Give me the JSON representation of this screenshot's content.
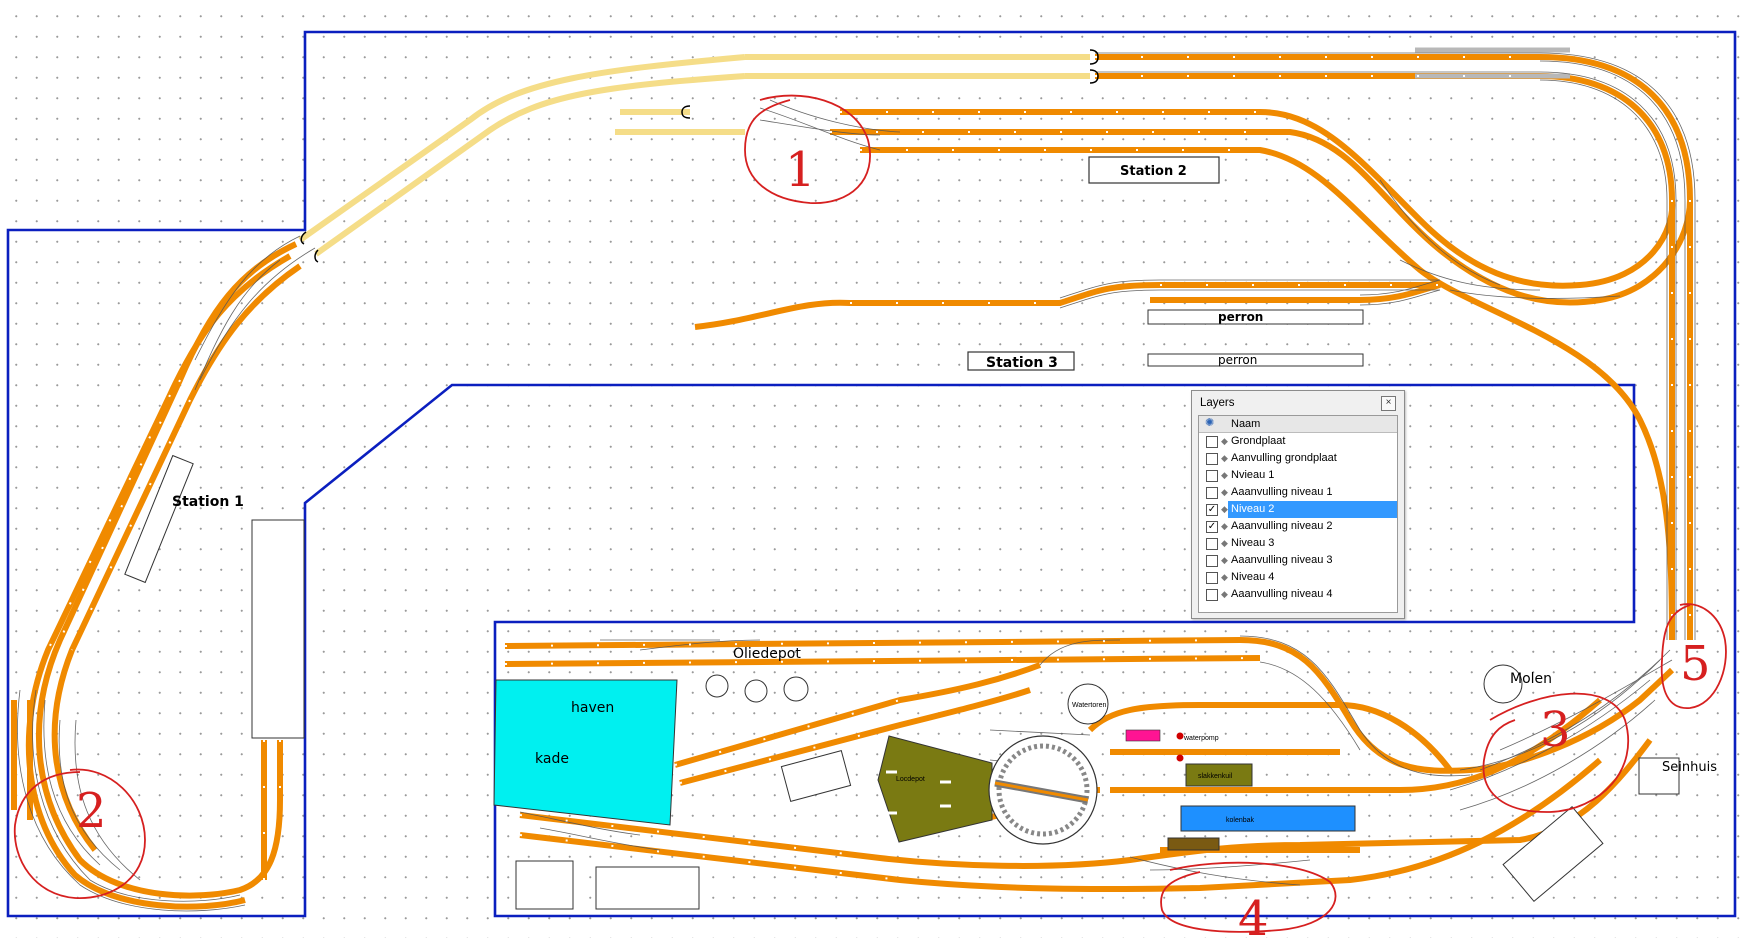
{
  "labels": {
    "station_1": "Station 1",
    "station_2": "Station 2",
    "station_3": "Station 3",
    "perron_top": "perron",
    "perron_bottom": "perron",
    "oliedepot": "Oliedepot",
    "haven": "haven",
    "kade": "kade",
    "molen": "Molen",
    "seinhuis": "Seinhuis",
    "waterpomp": "waterpomp",
    "slakkenkuil": "slakkenkuil",
    "kolenbak": "kolenbak",
    "watertoren": "Watertoren",
    "locdepot": "Locdepot"
  },
  "markers": [
    "1",
    "2",
    "3",
    "4",
    "5"
  ],
  "colors": {
    "board_outline": "#0b1fbf",
    "track_level2": "#f08a00",
    "track_other": "#f5dd88",
    "marker": "#d62020",
    "water": "#00f0f0",
    "depot": "#7a7a12",
    "kolenbak": "#1e90ff",
    "pink_marker": "#ff1493"
  },
  "layers_panel": {
    "title": "Layers",
    "close_icon": "close-icon",
    "column_header": "Naam",
    "items": [
      {
        "label": "Grondplaat",
        "checked": false,
        "selected": false
      },
      {
        "label": "Aanvulling grondplaat",
        "checked": false,
        "selected": false
      },
      {
        "label": "Nvieau 1",
        "checked": false,
        "selected": false
      },
      {
        "label": "Aaanvulling niveau 1",
        "checked": false,
        "selected": false
      },
      {
        "label": "Niveau 2",
        "checked": true,
        "selected": true
      },
      {
        "label": "Aaanvulling niveau 2",
        "checked": true,
        "selected": false
      },
      {
        "label": "Niveau 3",
        "checked": false,
        "selected": false
      },
      {
        "label": "Aaanvulling niveau 3",
        "checked": false,
        "selected": false
      },
      {
        "label": "Niveau 4",
        "checked": false,
        "selected": false
      },
      {
        "label": "Aaanvulling niveau 4",
        "checked": false,
        "selected": false
      }
    ]
  }
}
